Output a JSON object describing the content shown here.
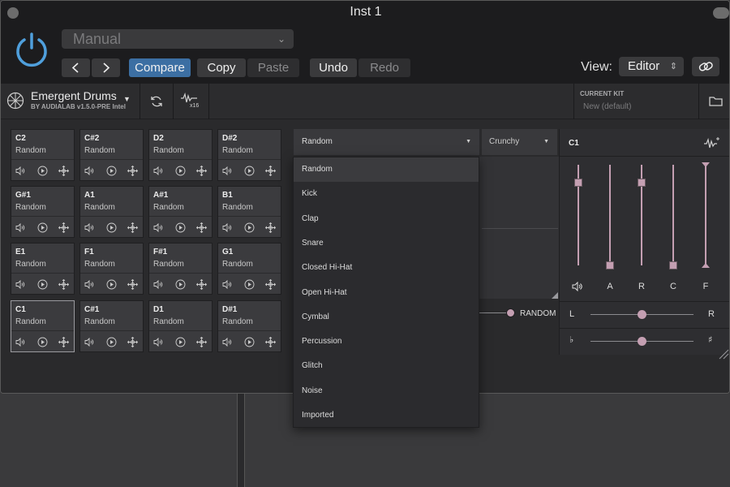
{
  "window": {
    "title": "Inst 1"
  },
  "header": {
    "preset": "Manual",
    "compare": "Compare",
    "copy": "Copy",
    "paste": "Paste",
    "undo": "Undo",
    "redo": "Redo",
    "view_label": "View:",
    "view_value": "Editor"
  },
  "plugin": {
    "name": "Emergent Drums",
    "byline": "BY AUDIALAB  v1.5.0-PRE Intel",
    "multiout_label": "x16",
    "kit_label": "CURRENT KIT",
    "kit_name": "New (default)"
  },
  "pads": [
    {
      "note": "C2",
      "type": "Random"
    },
    {
      "note": "C#2",
      "type": "Random"
    },
    {
      "note": "D2",
      "type": "Random"
    },
    {
      "note": "D#2",
      "type": "Random"
    },
    {
      "note": "G#1",
      "type": "Random"
    },
    {
      "note": "A1",
      "type": "Random"
    },
    {
      "note": "A#1",
      "type": "Random"
    },
    {
      "note": "B1",
      "type": "Random"
    },
    {
      "note": "E1",
      "type": "Random"
    },
    {
      "note": "F1",
      "type": "Random"
    },
    {
      "note": "F#1",
      "type": "Random"
    },
    {
      "note": "G1",
      "type": "Random"
    },
    {
      "note": "C1",
      "type": "Random"
    },
    {
      "note": "C#1",
      "type": "Random"
    },
    {
      "note": "D1",
      "type": "Random"
    },
    {
      "note": "D#1",
      "type": "Random"
    }
  ],
  "selected_pad": "C1",
  "type_select": {
    "value": "Random"
  },
  "character_select": {
    "value": "Crunchy"
  },
  "random_label": "RANDOM",
  "menu": {
    "items": [
      "Random",
      "Kick",
      "Clap",
      "Snare",
      "Closed Hi-Hat",
      "Open Hi-Hat",
      "Cymbal",
      "Percussion",
      "Glitch",
      "Noise",
      "Imported"
    ],
    "selected": "Random"
  },
  "envelope": {
    "title": "C1",
    "labels": [
      "A",
      "R",
      "C",
      "F"
    ],
    "volume_level": 0.82,
    "attack_level": 0.0,
    "release_level": 0.82,
    "curve_level": 0.0,
    "filter_level": 1.0,
    "pan_left": "L",
    "pan_right": "R",
    "pitch_flat": "♭",
    "pitch_sharp": "♯",
    "pan": 0.5,
    "pitch": 0.5
  },
  "colors": {
    "accent": "#c49fb2",
    "compare": "#3c6fa3",
    "power": "#4f9fdc"
  }
}
